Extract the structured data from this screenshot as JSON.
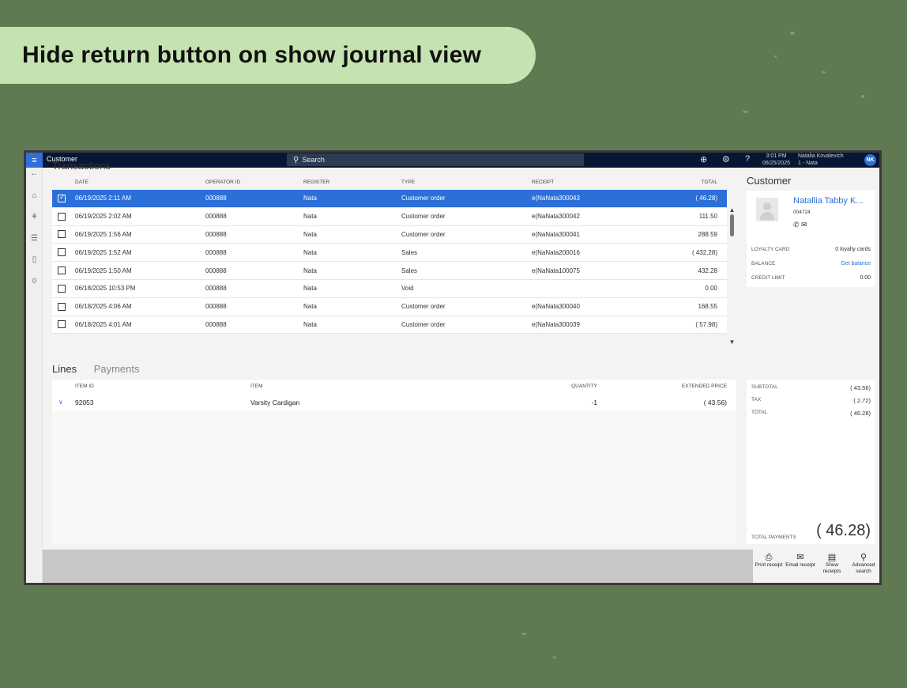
{
  "banner": {
    "title": "Hide return button on show journal view"
  },
  "topbar": {
    "app_title": "Customer",
    "search_label": "Search",
    "time": "3:01 PM",
    "date": "06/25/2025",
    "user_name": "Natalia Kovalevich",
    "register": "1 - Nata",
    "initials": "NK",
    "help": "?"
  },
  "leftnav": {
    "badge_count": "0"
  },
  "transactions": {
    "title": "Transactions",
    "columns": [
      "DATE",
      "OPERATOR ID",
      "REGISTER",
      "TYPE",
      "RECEIPT",
      "TOTAL"
    ],
    "rows": [
      {
        "date": "06/19/2025 2:11 AM",
        "operator": "000888",
        "register": "Nata",
        "type": "Customer order",
        "receipt": "e(NaNata300043",
        "total": "( 46.28)",
        "selected": true
      },
      {
        "date": "06/19/2025 2:02 AM",
        "operator": "000888",
        "register": "Nata",
        "type": "Customer order",
        "receipt": "e(NaNata300042",
        "total": "111.50"
      },
      {
        "date": "06/19/2025 1:56 AM",
        "operator": "000888",
        "register": "Nata",
        "type": "Customer order",
        "receipt": "e(NaNata300041",
        "total": "288.59"
      },
      {
        "date": "06/19/2025 1:52 AM",
        "operator": "000888",
        "register": "Nata",
        "type": "Sales",
        "receipt": "e(NaNata200016",
        "total": "( 432.28)"
      },
      {
        "date": "06/19/2025 1:50 AM",
        "operator": "000888",
        "register": "Nata",
        "type": "Sales",
        "receipt": "e(NaNata100075",
        "total": "432.28"
      },
      {
        "date": "06/18/2025 10:53 PM",
        "operator": "000888",
        "register": "Nata",
        "type": "Void",
        "receipt": "",
        "total": "0.00"
      },
      {
        "date": "06/18/2025 4:06 AM",
        "operator": "000888",
        "register": "Nata",
        "type": "Customer order",
        "receipt": "e(NaNata300040",
        "total": "168.55"
      },
      {
        "date": "06/18/2025 4:01 AM",
        "operator": "000888",
        "register": "Nata",
        "type": "Customer order",
        "receipt": "e(NaNata300039",
        "total": "( 57.98)"
      }
    ]
  },
  "lines": {
    "tab_lines": "Lines",
    "tab_payments": "Payments",
    "columns": [
      "ITEM ID",
      "ITEM",
      "QUANTITY",
      "EXTENDED PRICE"
    ],
    "rows": [
      {
        "item_id": "92053",
        "item": "Varsity Cardigan",
        "quantity": "-1",
        "extended_price": "( 43.56)"
      }
    ]
  },
  "customer": {
    "title": "Customer",
    "name": "Natallia Tabby K...",
    "id": "004724",
    "loyalty_label": "LOYALTY CARD",
    "loyalty_value": "0 loyalty cards",
    "balance_label": "BALANCE",
    "balance_value": "Get balance",
    "credit_label": "CREDIT LIMIT",
    "credit_value": "0.00"
  },
  "totals": {
    "subtotal_label": "SUBTOTAL",
    "subtotal": "( 43.56)",
    "tax_label": "TAX",
    "tax": "( 2.72)",
    "total_label": "TOTAL",
    "total": "( 46.28)",
    "payments_label": "TOTAL PAYMENTS",
    "payments": "( 46.28)"
  },
  "actions": [
    {
      "label": "Print receipt",
      "icon": "printer-icon"
    },
    {
      "label": "Email receipt",
      "icon": "mail-icon"
    },
    {
      "label": "Show receipts",
      "icon": "receipt-icon"
    },
    {
      "label": "Advanced search",
      "icon": "search-icon"
    }
  ],
  "colors": {
    "accent": "#2c6fd8",
    "topbar": "#071733",
    "banner": "#c5e3b1",
    "background": "#5f7a52"
  }
}
